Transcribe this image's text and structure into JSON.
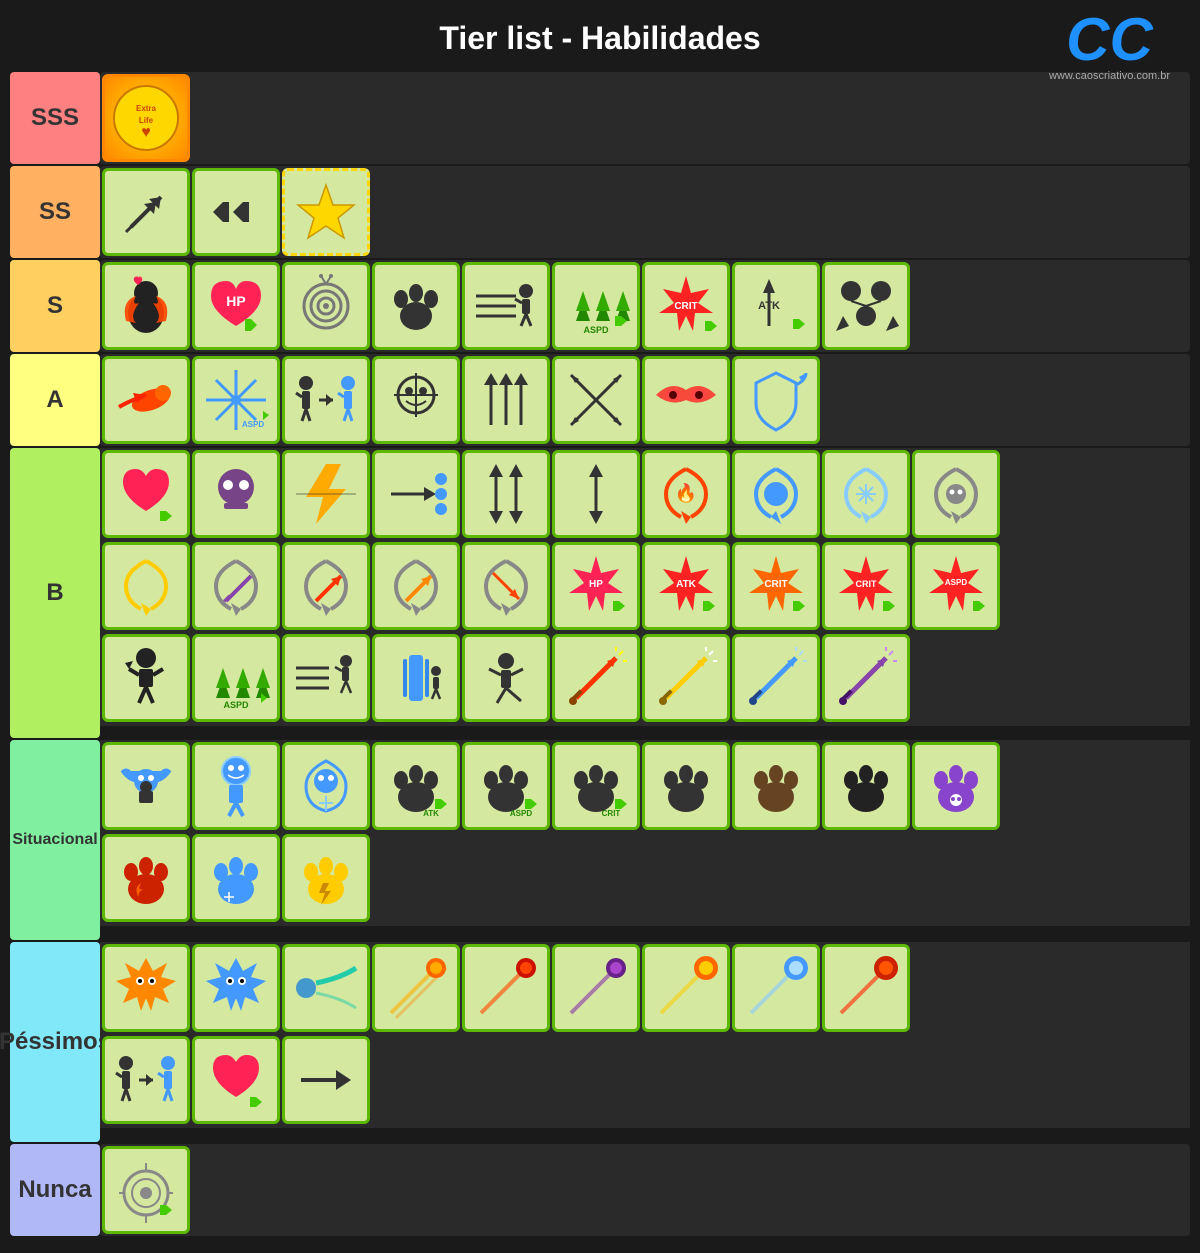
{
  "header": {
    "title": "Tier list - Habilidades",
    "logo_text": "CC",
    "logo_url": "www.caoscriativo.com.br"
  },
  "tiers": [
    {
      "label": "SSS",
      "color": "#ff8080"
    },
    {
      "label": "SS",
      "color": "#ffb060"
    },
    {
      "label": "S",
      "color": "#ffd060"
    },
    {
      "label": "A",
      "color": "#ffff80"
    },
    {
      "label": "B",
      "color": "#b0f060"
    },
    {
      "label": "Situacional",
      "color": "#80f0a0"
    },
    {
      "label": "Péssimos",
      "color": "#80e8f8"
    },
    {
      "label": "Nunca",
      "color": "#b0b8f8"
    }
  ]
}
